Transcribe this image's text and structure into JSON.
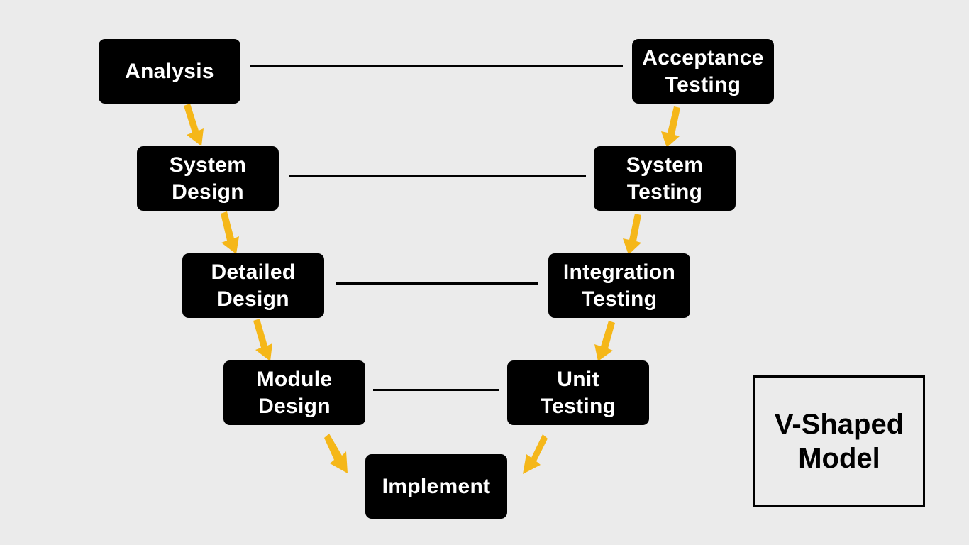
{
  "diagram": {
    "title_lines": [
      "V-Shaped",
      "Model"
    ],
    "accent_color": "#f5b719",
    "left_branch": [
      {
        "lines": [
          "Analysis"
        ]
      },
      {
        "lines": [
          "System",
          "Design"
        ]
      },
      {
        "lines": [
          "Detailed",
          "Design"
        ]
      },
      {
        "lines": [
          "Module",
          "Design"
        ]
      }
    ],
    "bottom": {
      "lines": [
        "Implement"
      ]
    },
    "right_branch": [
      {
        "lines": [
          "Acceptance",
          "Testing"
        ]
      },
      {
        "lines": [
          "System",
          "Testing"
        ]
      },
      {
        "lines": [
          "Integration",
          "Testing"
        ]
      },
      {
        "lines": [
          "Unit",
          "Testing"
        ]
      }
    ],
    "connections": [
      [
        "Analysis",
        "Acceptance Testing"
      ],
      [
        "System Design",
        "System Testing"
      ],
      [
        "Detailed Design",
        "Integration Testing"
      ],
      [
        "Module Design",
        "Unit Testing"
      ]
    ]
  }
}
